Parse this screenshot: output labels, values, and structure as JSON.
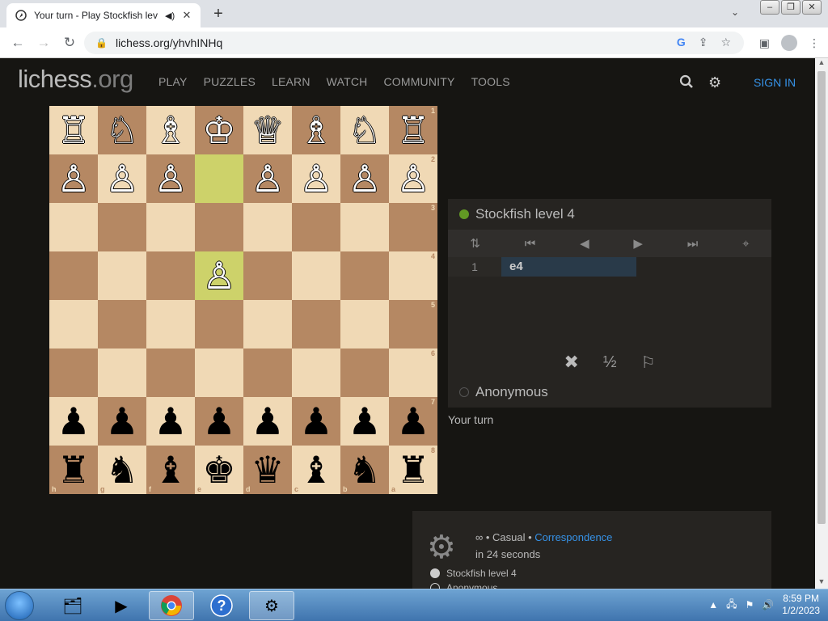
{
  "browser": {
    "tab_title": "Your turn - Play Stockfish lev",
    "url": "lichess.org/yhvhINHq"
  },
  "site": {
    "logo_main": "lichess",
    "logo_tld": ".org",
    "nav": [
      "PLAY",
      "PUZZLES",
      "LEARN",
      "WATCH",
      "COMMUNITY",
      "TOOLS"
    ],
    "signin": "SIGN IN"
  },
  "board": {
    "ranks": [
      "1",
      "2",
      "3",
      "4",
      "5",
      "6",
      "7",
      "8"
    ],
    "files": [
      "h",
      "g",
      "f",
      "e",
      "d",
      "c",
      "b",
      "a"
    ],
    "rows": [
      [
        "♖",
        "♘",
        "♗",
        "♔",
        "♕",
        "♗",
        "♘",
        "♖"
      ],
      [
        "♙",
        "♙",
        "♙",
        "",
        "♙",
        "♙",
        "♙",
        "♙"
      ],
      [
        "",
        "",
        "",
        "",
        "",
        "",
        "",
        ""
      ],
      [
        "",
        "",
        "",
        "♙",
        "",
        "",
        "",
        ""
      ],
      [
        "",
        "",
        "",
        "",
        "",
        "",
        "",
        ""
      ],
      [
        "",
        "",
        "",
        "",
        "",
        "",
        "",
        ""
      ],
      [
        "♟",
        "♟",
        "♟",
        "♟",
        "♟",
        "♟",
        "♟",
        "♟"
      ],
      [
        "♜",
        "♞",
        "♝",
        "♚",
        "♛",
        "♝",
        "♞",
        "♜"
      ]
    ]
  },
  "game": {
    "opponent": "Stockfish level 4",
    "player": "Anonymous",
    "move_number": "1",
    "move": "e4",
    "draw_label": "½",
    "status": "Your turn",
    "speed": "∞ • Casual •",
    "mode": "Correspondence",
    "timer": "in 24 seconds",
    "list_player1": "Stockfish level 4",
    "list_player2": "Anonymous"
  },
  "taskbar": {
    "time": "8:59 PM",
    "date": "1/2/2023"
  }
}
